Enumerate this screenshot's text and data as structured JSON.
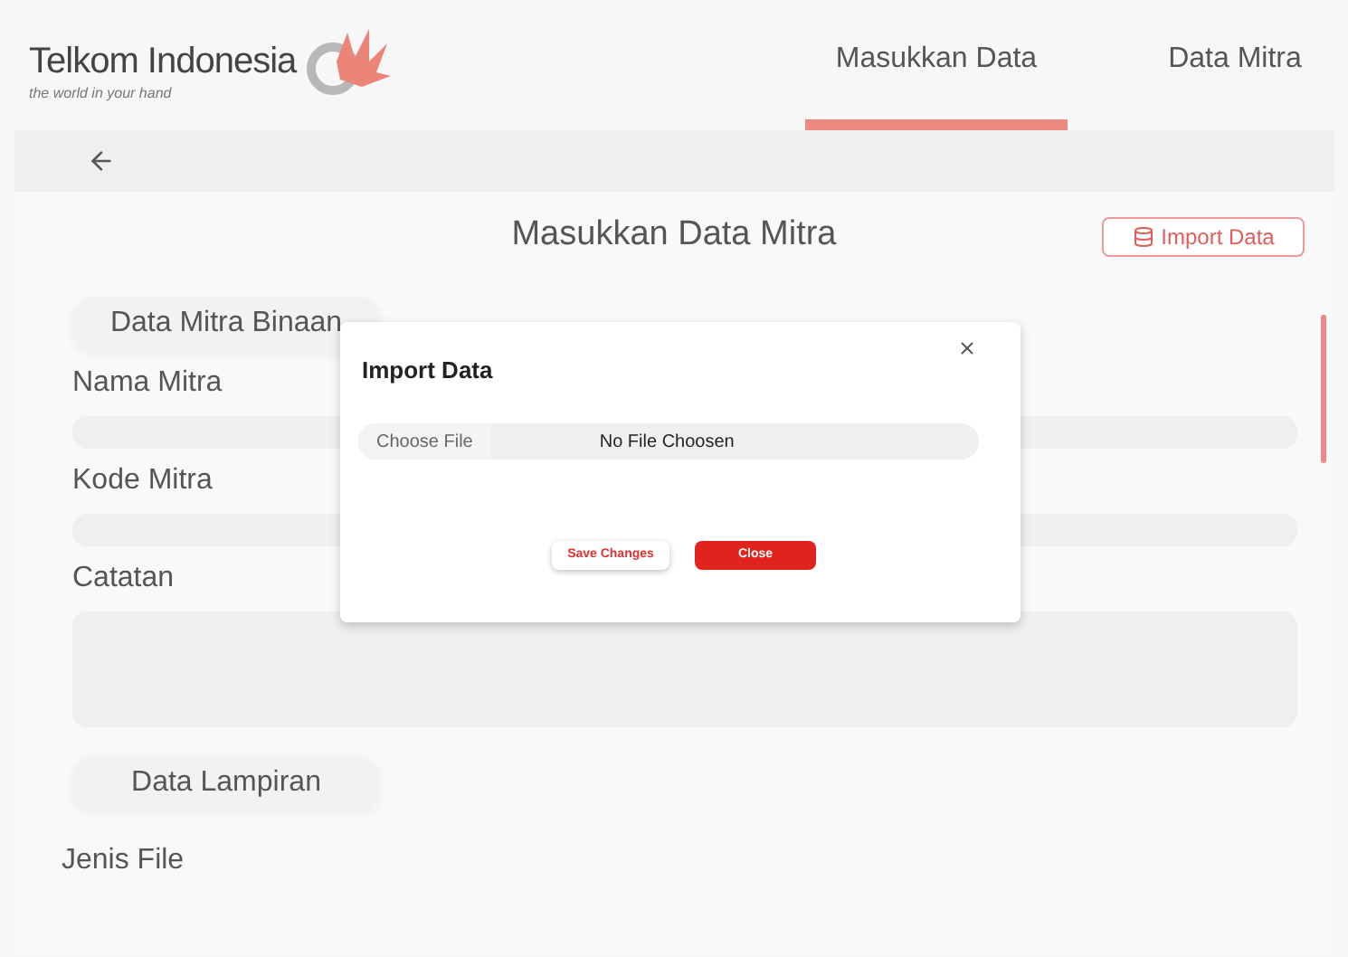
{
  "brand": {
    "name": "Telkom Indonesia",
    "tagline": "the world in your hand"
  },
  "tabs": [
    {
      "label": "Masukkan Data",
      "selected": true
    },
    {
      "label": "Data Mitra",
      "selected": false
    }
  ],
  "page": {
    "title": "Masukkan Data Mitra",
    "import_button": "Import Data"
  },
  "sections": [
    {
      "heading": "Data Mitra Binaan",
      "fields": [
        {
          "label": "Nama Mitra",
          "kind": "input"
        },
        {
          "label": "Kode Mitra",
          "kind": "input"
        },
        {
          "label": "Catatan",
          "kind": "textarea"
        }
      ]
    },
    {
      "heading": "Data Lampiran",
      "fields": [
        {
          "label": "Jenis File",
          "kind": "label"
        }
      ]
    }
  ],
  "modal": {
    "title": "Import Data",
    "file_button": "Choose File",
    "file_status": "No File Choosen",
    "buttons": [
      {
        "label": "Save Changes",
        "kind": "secondary"
      },
      {
        "label": "Close",
        "kind": "primary"
      }
    ]
  }
}
